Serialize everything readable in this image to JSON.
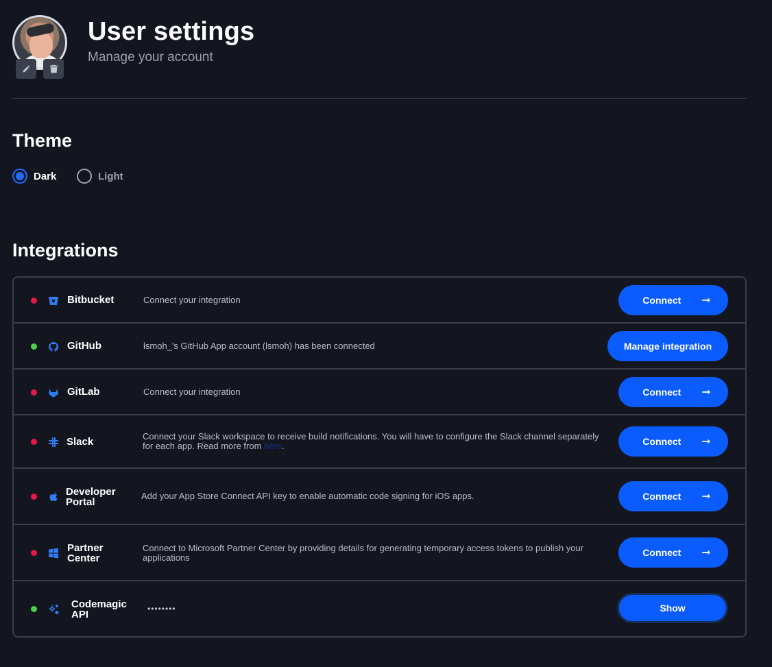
{
  "header": {
    "title": "User settings",
    "subtitle": "Manage your account",
    "edit_icon": "pencil-icon",
    "delete_icon": "trash-icon"
  },
  "theme": {
    "title": "Theme",
    "options": [
      {
        "label": "Dark",
        "selected": true
      },
      {
        "label": "Light",
        "selected": false
      }
    ]
  },
  "integrations": {
    "title": "Integrations",
    "items": [
      {
        "name": "Bitbucket",
        "status": "disconnected",
        "icon": "bitbucket-icon",
        "description": "Connect your integration",
        "button": "Connect"
      },
      {
        "name": "GitHub",
        "status": "connected",
        "icon": "github-icon",
        "description": "lsmoh_'s GitHub App account (lsmoh) has been connected",
        "button": "Manage integration"
      },
      {
        "name": "GitLab",
        "status": "disconnected",
        "icon": "gitlab-icon",
        "description": "Connect your integration",
        "button": "Connect"
      },
      {
        "name": "Slack",
        "status": "disconnected",
        "icon": "slack-icon",
        "description_line1": "Connect your Slack workspace to receive build notifications. You will have to configure the Slack channel separately",
        "description_line2": "for each app. Read more from",
        "link_text": "here",
        "description_end": ".",
        "button": "Connect"
      },
      {
        "name_line1": "Developer",
        "name_line2": "Portal",
        "status": "disconnected",
        "icon": "apple-icon",
        "description": "Add your App Store Connect API key to enable automatic code signing for iOS apps.",
        "button": "Connect"
      },
      {
        "name_line1": "Partner",
        "name_line2": "Center",
        "status": "disconnected",
        "icon": "windows-icon",
        "description_line1": "Connect to Microsoft Partner Center by providing details for generating temporary access tokens to publish your",
        "description_line2": "applications",
        "button": "Connect"
      },
      {
        "name_line1": "Codemagic",
        "name_line2": "API",
        "status": "connected",
        "icon": "gears-icon",
        "masked_value": "••••••••",
        "button": "Show"
      }
    ]
  },
  "colors": {
    "background": "#13161f",
    "accent": "#0b5cff",
    "status_connected": "#4bd04b",
    "status_disconnected": "#e8174a"
  }
}
